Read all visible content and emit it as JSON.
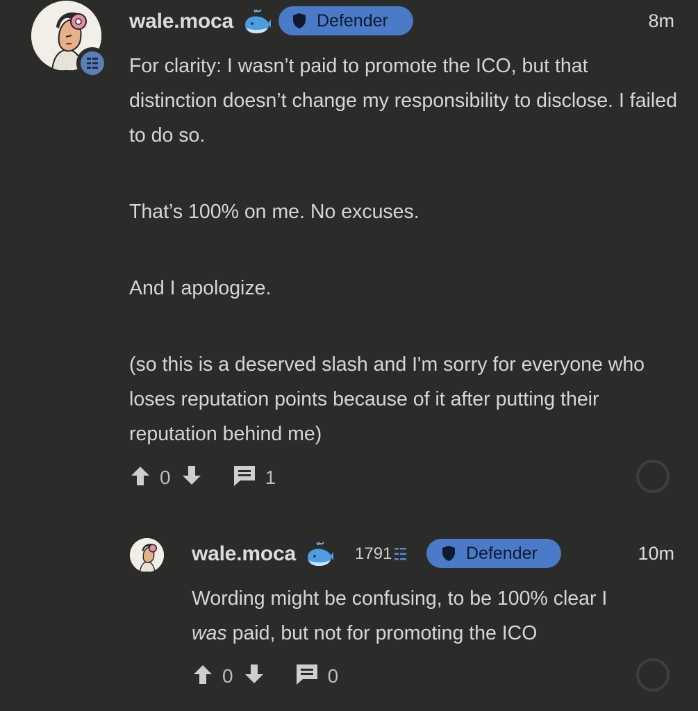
{
  "colors": {
    "background": "#2b2b2a",
    "badge_bg": "#4a7ac8",
    "rank_badge": "#5a7fb8",
    "text": "#d6d6d6"
  },
  "post": {
    "username": "wale.moca",
    "user_icon": "whale-emoji",
    "badge_label": "Defender",
    "time": "8m",
    "paragraphs": [
      "For clarity: I wasn’t paid to promote the ICO, but that distinction doesn’t change my responsibility to disclose. I failed to do so.",
      "That’s 100% on me. No excuses.",
      "And I apologize.",
      "(so this is a deserved slash and I'm sorry for everyone who loses reputation points because of it after putting their reputation behind me)"
    ],
    "upvotes": "0",
    "comments": "1"
  },
  "reply": {
    "username": "wale.moca",
    "user_icon": "whale-emoji",
    "score": "1791",
    "badge_label": "Defender",
    "time": "10m",
    "text_emphasis": "was",
    "text_line1": "Wording might be confusing, to be 100% clear I",
    "text_line2_rest": " paid, but not for promoting the ICO",
    "upvotes": "0",
    "comments": "0"
  }
}
